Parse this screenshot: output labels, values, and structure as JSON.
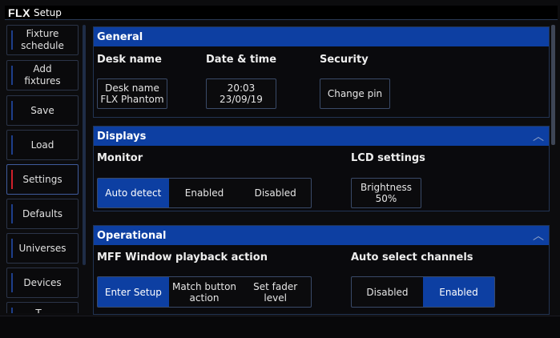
{
  "window": {
    "logo": "FLX",
    "title": "Setup"
  },
  "sidebar": {
    "items": [
      {
        "label": "Fixture\nschedule"
      },
      {
        "label": "Add\nfixtures"
      },
      {
        "label": "Save"
      },
      {
        "label": "Load"
      },
      {
        "label": "Settings",
        "active": true
      },
      {
        "label": "Defaults"
      },
      {
        "label": "Universes"
      },
      {
        "label": "Devices"
      },
      {
        "label": "T..."
      }
    ]
  },
  "general": {
    "title": "General",
    "desk_name_label": "Desk name",
    "desk_name_button": "Desk name\nFLX Phantom",
    "datetime_label": "Date & time",
    "datetime_button": "20:03\n23/09/19",
    "security_label": "Security",
    "security_button": "Change pin"
  },
  "displays": {
    "title": "Displays",
    "monitor_label": "Monitor",
    "monitor_options": [
      "Auto detect",
      "Enabled",
      "Disabled"
    ],
    "monitor_selected": "Auto detect",
    "lcd_label": "LCD settings",
    "brightness_button": "Brightness\n50%"
  },
  "operational": {
    "title": "Operational",
    "mff_label": "MFF Window playback action",
    "mff_options": [
      "Enter Setup",
      "Match button\naction",
      "Set fader\nlevel"
    ],
    "mff_selected": "Enter Setup",
    "auto_label": "Auto select channels",
    "auto_options": [
      "Disabled",
      "Enabled"
    ],
    "auto_selected": "Enabled"
  },
  "icons": {
    "collapse": "chevron-up-icon"
  },
  "colors": {
    "accent": "#0d3fa2",
    "active_marker": "#d0202a"
  }
}
